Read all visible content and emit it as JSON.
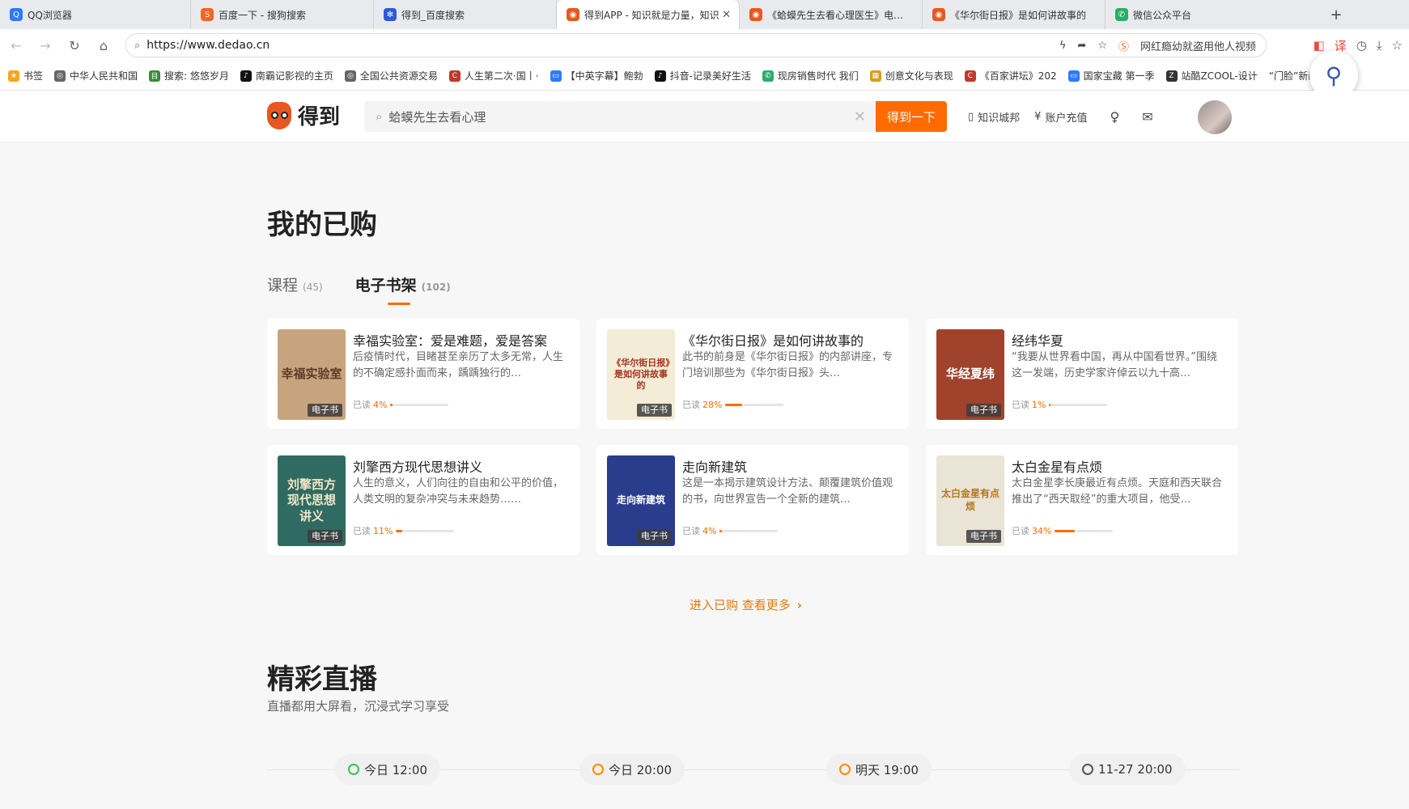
{
  "browser": {
    "tabs": [
      {
        "label": "QQ浏览器",
        "icon_color": "#2b7bff"
      },
      {
        "label": "百度一下 - 搜狗搜索",
        "icon_color": "#f26522"
      },
      {
        "label": "得到_百度搜索",
        "icon_color": "#2b5bd6"
      },
      {
        "label": "得到APP - 知识就是力量，知识",
        "icon_color": "#e8571f"
      },
      {
        "label": "《蛤蟆先生去看心理医生》电子书",
        "icon_color": "#e8571f"
      },
      {
        "label": "《华尔街日报》是如何讲故事的",
        "icon_color": "#e8571f"
      },
      {
        "label": "微信公众平台",
        "icon_color": "#2aae67"
      }
    ],
    "active_tab": 3,
    "new_tab": "+",
    "url": "https://www.dedao.cn",
    "address_hint": "网红瘾幼就盗用他人视频",
    "bookmarks": [
      {
        "label": "书签",
        "icon_color": "#f5a623"
      },
      {
        "label": "中华人民共和国",
        "icon_color": "#666"
      },
      {
        "label": "搜索: 悠悠岁月",
        "icon_color": "#3a8a3a"
      },
      {
        "label": "南霸记影视的主页",
        "icon_color": "#111"
      },
      {
        "label": "全国公共资源交易",
        "icon_color": "#666"
      },
      {
        "label": "人生第二次·国丨·",
        "icon_color": "#c0392b"
      },
      {
        "label": "【中英字幕】鲍勃",
        "icon_color": "#2b7bff"
      },
      {
        "label": "抖音-记录美好生活",
        "icon_color": "#111"
      },
      {
        "label": "现房销售时代 我们",
        "icon_color": "#2aae67"
      },
      {
        "label": "创意文化与表现",
        "icon_color": "#d4a017"
      },
      {
        "label": "《百家讲坛》202",
        "icon_color": "#c0392b"
      },
      {
        "label": "国家宝藏 第一季",
        "icon_color": "#2b7bff"
      },
      {
        "label": "站酷ZCOOL-设计",
        "icon_color": "#333"
      },
      {
        "label": "“门脸”新画",
        "icon_color": "#999"
      }
    ]
  },
  "site": {
    "logo_text": "得到",
    "search_value": "蛤蟆先生去看心理",
    "search_button": "得到一下",
    "links": [
      "知识城邦",
      "账户充值"
    ]
  },
  "purchased": {
    "title": "我的已购",
    "tabs": [
      {
        "label": "课程",
        "count": "(45)"
      },
      {
        "label": "电子书架",
        "count": "(102)"
      }
    ],
    "active_tab": 1,
    "badge": "电子书",
    "progress_label": "已读",
    "books": [
      {
        "title": "幸福实验室：爱是难题，爱是答案",
        "desc": "后疫情时代，目睹甚至亲历了太多无常，人生的不确定感扑面而来，踽踽独行的…",
        "progress": "4%",
        "progress_value": 4,
        "cover_text": "幸福实验室",
        "cover_color": "#c8a47e"
      },
      {
        "title": "《华尔街日报》是如何讲故事的",
        "desc": "此书的前身是《华尔街日报》的内部讲座，专门培训那些为《华尔街日报》头…",
        "progress": "28%",
        "progress_value": 28,
        "cover_text": "《华尔街日报》是如何讲故事的",
        "cover_color": "#f3ecd6"
      },
      {
        "title": "经纬华夏",
        "desc": "“我要从世界看中国，再从中国看世界。”围绕这一发端，历史学家许倬云以九十高…",
        "progress": "1%",
        "progress_value": 1,
        "cover_text": "华经夏纬",
        "cover_color": "#a0432c"
      },
      {
        "title": "刘擎西方现代思想讲义",
        "desc": "人生的意义，人们向往的自由和公平的价值，人类文明的复杂冲突与未来趋势……",
        "progress": "11%",
        "progress_value": 11,
        "cover_text": "刘擎西方现代思想讲义",
        "cover_color": "#2f6b63"
      },
      {
        "title": "走向新建筑",
        "desc": "这是一本揭示建筑设计方法、颠覆建筑价值观的书，向世界宣告一个全新的建筑…",
        "progress": "4%",
        "progress_value": 4,
        "cover_text": "走向新建筑",
        "cover_color": "#2a3c8c"
      },
      {
        "title": "太白金星有点烦",
        "desc": "太白金星李长庚最近有点烦。天庭和西天联合推出了“西天取经”的重大项目，他受…",
        "progress": "34%",
        "progress_value": 34,
        "cover_text": "太白金星有点烦",
        "cover_color": "#e9e4d6"
      }
    ],
    "more_link": "进入已购 查看更多"
  },
  "live": {
    "title": "精彩直播",
    "subtitle": "直播都用大屏看，沉浸式学习享受",
    "times": [
      {
        "label": "今日 12:00",
        "status": "green"
      },
      {
        "label": "今日 20:00",
        "status": "orange"
      },
      {
        "label": "明天 19:00",
        "status": "orange"
      },
      {
        "label": "11-27 20:00",
        "status": "gray"
      }
    ]
  }
}
